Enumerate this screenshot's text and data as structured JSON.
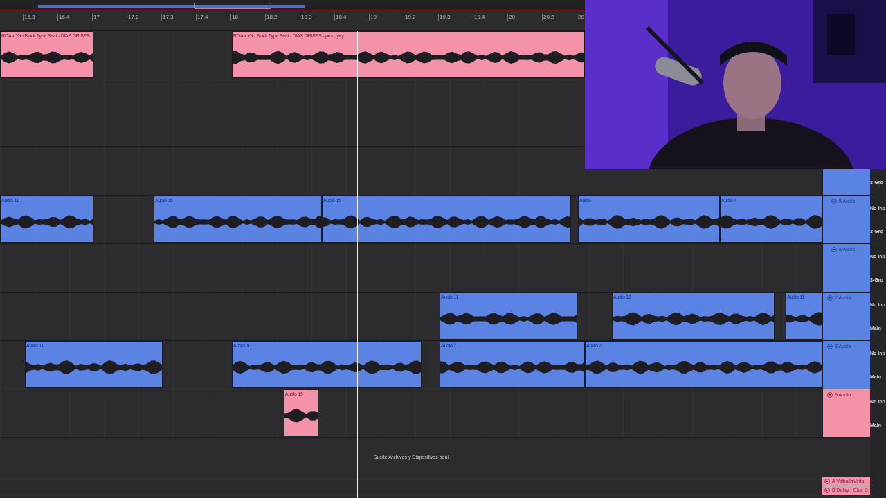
{
  "ruler": {
    "labels": [
      "16.3",
      "16.4",
      "17",
      "17.2",
      "17.3",
      "17.4",
      "18",
      "18.2",
      "18.3",
      "18.4",
      "19",
      "19.2",
      "19.3",
      "19.4",
      "20",
      "20.2",
      "20"
    ]
  },
  "tracks": [
    {
      "kind": "lane",
      "color": "#f492aa",
      "clips": [
        {
          "name": "ROA x Yan Block Type Beat - DIAS GRISES"
        },
        {
          "name": "ROA x Yan Block Type Beat - DIAS GRISES - prod. yey"
        }
      ]
    },
    {
      "kind": "lane"
    },
    {
      "kind": "group",
      "color": "#5b83e3",
      "io": [
        "3-Gro"
      ]
    },
    {
      "kind": "track",
      "name": "5 Audio",
      "color": "#5b83e3",
      "io": [
        "No Inp",
        "3-Gro"
      ],
      "clips": [
        {
          "name": "Audio 11"
        },
        {
          "name": "Audio 15"
        },
        {
          "name": "Audio 15"
        },
        {
          "name": "Audio"
        },
        {
          "name": "Audio 4"
        }
      ]
    },
    {
      "kind": "track",
      "name": "6 Audio",
      "color": "#5b83e3",
      "io": [
        "No Inp",
        "3-Gro"
      ]
    },
    {
      "kind": "track",
      "name": "7 Audio",
      "color": "#5b83e3",
      "io": [
        "No Inp",
        "Main"
      ],
      "clips": [
        {
          "name": "Audio 11"
        },
        {
          "name": "Audio 13"
        },
        {
          "name": "Audio 11"
        }
      ]
    },
    {
      "kind": "track",
      "name": "8 Audio",
      "color": "#5b83e3",
      "io": [
        "No Inp",
        "Main"
      ],
      "clips": [
        {
          "name": "Audio 11"
        },
        {
          "name": "Audio 10"
        },
        {
          "name": "Audio 7"
        },
        {
          "name": "Audio 2"
        }
      ]
    },
    {
      "kind": "track",
      "name": "9 Audio",
      "color": "#f492aa",
      "io": [
        "No Inp",
        "Main"
      ],
      "clips": [
        {
          "name": "Audio 15"
        }
      ]
    }
  ],
  "drop_hint": "Suelte Archivos y Dispositivos aquí",
  "returns": [
    {
      "name": "A ValhallaVinta",
      "color": "#f492aa"
    },
    {
      "name": "B Delay | Glue C",
      "color": "#f492aa"
    }
  ]
}
